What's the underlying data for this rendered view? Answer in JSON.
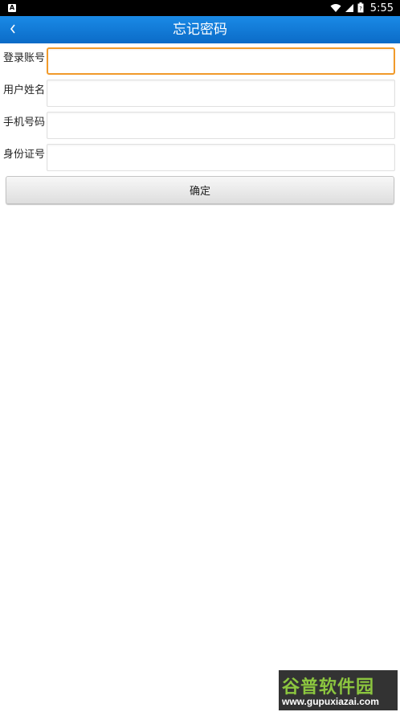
{
  "status_bar": {
    "time": "5:55",
    "notification_icon": "a-icon"
  },
  "header": {
    "title": "忘记密码",
    "back_icon": "chevron-left-icon"
  },
  "form": {
    "fields": [
      {
        "label": "登录账号",
        "value": ""
      },
      {
        "label": "用户姓名",
        "value": ""
      },
      {
        "label": "手机号码",
        "value": ""
      },
      {
        "label": "身份证号",
        "value": ""
      }
    ],
    "submit_label": "确定"
  },
  "watermark": {
    "title": "谷普软件园",
    "url": "www.gupuxiazai.com"
  },
  "colors": {
    "header": "#0b6bc7",
    "focus_border": "#f19a2a",
    "watermark_green": "#8cc63f"
  }
}
